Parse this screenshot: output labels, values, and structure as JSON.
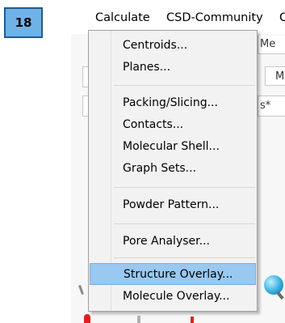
{
  "step_badge": "18",
  "menubar": {
    "items": [
      {
        "label": "Calculate"
      },
      {
        "label": "CSD-Community"
      },
      {
        "label": "C"
      }
    ]
  },
  "toolbar_fragments": [
    "Me",
    "M",
    "s*"
  ],
  "dropdown": {
    "items": [
      {
        "label": "Centroids..."
      },
      {
        "label": "Planes..."
      },
      {
        "label": "Packing/Slicing..."
      },
      {
        "label": "Contacts..."
      },
      {
        "label": "Molecular Shell..."
      },
      {
        "label": "Graph Sets..."
      },
      {
        "label": "Powder Pattern..."
      },
      {
        "label": "Pore Analyser..."
      },
      {
        "label": "Structure Overlay...",
        "selected": true
      },
      {
        "label": "Molecule Overlay..."
      }
    ]
  },
  "colors": {
    "badge_fill": "#71b2e6",
    "badge_border": "#1f5a92",
    "selection": "#99c8f1",
    "menu_bg": "#f2f2f2"
  }
}
